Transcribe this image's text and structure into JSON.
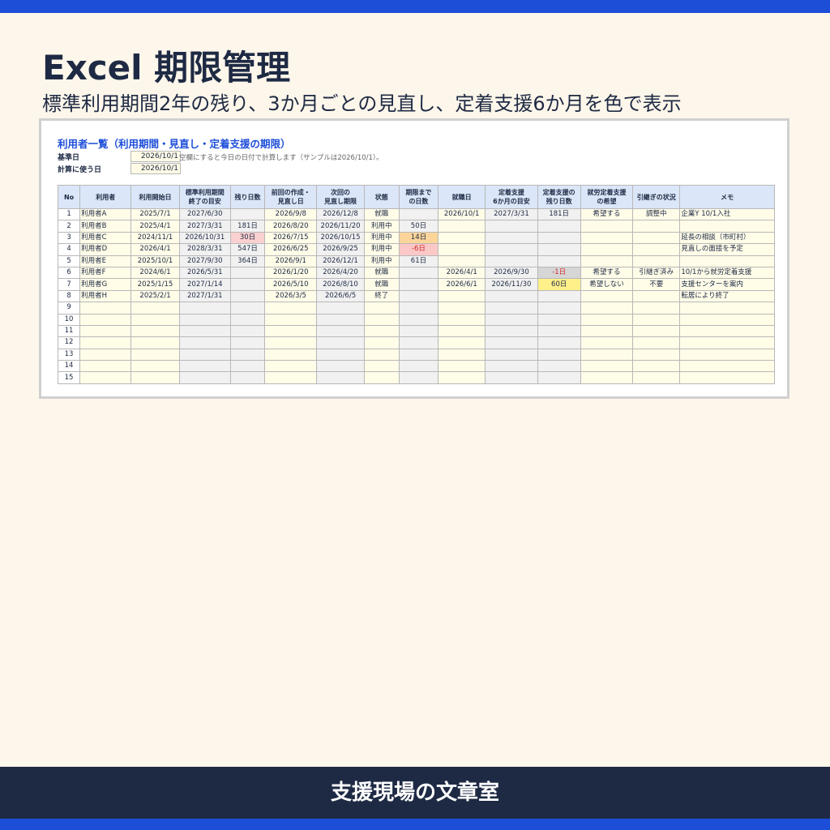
{
  "header": {
    "title": "Excel 期限管理",
    "subtitle": "標準利用期間2年の残り、3か月ごとの見直し、定着支援6か月を色で表示"
  },
  "sheet": {
    "title": "利用者一覧（利用期間・見直し・定着支援の期限）",
    "base_date_label": "基準日",
    "base_date_value": "2026/10/1",
    "base_date_note": "空欄にすると今日の日付で計算します（サンプルは2026/10/1）。",
    "calc_date_label": "計算に使う日",
    "calc_date_value": "2026/10/1",
    "columns": [
      "No",
      "利用者",
      "利用開始日",
      "標準利用期間\n終了の目安",
      "残り日数",
      "前回の作成・\n見直し日",
      "次回の\n見直し期限",
      "状態",
      "期限まで\nの日数",
      "就職日",
      "定着支援\n6か月の目安",
      "定着支援の\n残り日数",
      "就労定着支援\nの希望",
      "引継ぎの状況",
      "メモ"
    ],
    "rows": [
      [
        "1",
        "利用者A",
        "2025/7/1",
        "2027/6/30",
        "",
        "2026/9/8",
        "2026/12/8",
        "就職",
        "",
        "2026/10/1",
        "2027/3/31",
        "181日",
        "希望する",
        "調整中",
        "企業Y 10/1入社"
      ],
      [
        "2",
        "利用者B",
        "2025/4/1",
        "2027/3/31",
        "181日",
        "2026/8/20",
        "2026/11/20",
        "利用中",
        "50日",
        "",
        "",
        "",
        "",
        "",
        ""
      ],
      [
        "3",
        "利用者C",
        "2024/11/1",
        "2026/10/31",
        "30日",
        "2026/7/15",
        "2026/10/15",
        "利用中",
        "14日",
        "",
        "",
        "",
        "",
        "",
        "延長の相談（市町村）"
      ],
      [
        "4",
        "利用者D",
        "2026/4/1",
        "2028/3/31",
        "547日",
        "2026/6/25",
        "2026/9/25",
        "利用中",
        "-6日",
        "",
        "",
        "",
        "",
        "",
        "見直しの面接を予定"
      ],
      [
        "5",
        "利用者E",
        "2025/10/1",
        "2027/9/30",
        "364日",
        "2026/9/1",
        "2026/12/1",
        "利用中",
        "61日",
        "",
        "",
        "",
        "",
        "",
        ""
      ],
      [
        "6",
        "利用者F",
        "2024/6/1",
        "2026/5/31",
        "",
        "2026/1/20",
        "2026/4/20",
        "就職",
        "",
        "2026/4/1",
        "2026/9/30",
        "-1日",
        "希望する",
        "引継ぎ済み",
        "10/1から就労定着支援"
      ],
      [
        "7",
        "利用者G",
        "2025/1/15",
        "2027/1/14",
        "",
        "2026/5/10",
        "2026/8/10",
        "就職",
        "",
        "2026/6/1",
        "2026/11/30",
        "60日",
        "希望しない",
        "不要",
        "支援センターを案内"
      ],
      [
        "8",
        "利用者H",
        "2025/2/1",
        "2027/1/31",
        "",
        "2026/3/5",
        "2026/6/5",
        "終了",
        "",
        "",
        "",
        "",
        "",
        "",
        "転居により終了"
      ],
      [
        "9",
        "",
        "",
        "",
        "",
        "",
        "",
        "",
        "",
        "",
        "",
        "",
        "",
        "",
        ""
      ],
      [
        "10",
        "",
        "",
        "",
        "",
        "",
        "",
        "",
        "",
        "",
        "",
        "",
        "",
        "",
        ""
      ],
      [
        "11",
        "",
        "",
        "",
        "",
        "",
        "",
        "",
        "",
        "",
        "",
        "",
        "",
        "",
        ""
      ],
      [
        "12",
        "",
        "",
        "",
        "",
        "",
        "",
        "",
        "",
        "",
        "",
        "",
        "",
        "",
        ""
      ],
      [
        "13",
        "",
        "",
        "",
        "",
        "",
        "",
        "",
        "",
        "",
        "",
        "",
        "",
        "",
        ""
      ],
      [
        "14",
        "",
        "",
        "",
        "",
        "",
        "",
        "",
        "",
        "",
        "",
        "",
        "",
        "",
        ""
      ],
      [
        "15",
        "",
        "",
        "",
        "",
        "",
        "",
        "",
        "",
        "",
        "",
        "",
        "",
        "",
        ""
      ]
    ],
    "highlights": [
      {
        "row": 2,
        "col": 4,
        "style": "red-bg"
      },
      {
        "row": 2,
        "col": 8,
        "style": "orange-bg"
      },
      {
        "row": 3,
        "col": 8,
        "style": "pink-red"
      },
      {
        "row": 5,
        "col": 11,
        "style": "gray-red"
      },
      {
        "row": 6,
        "col": 11,
        "style": "yellow-bg"
      }
    ]
  },
  "footer": {
    "brand": "支援現場の文章室"
  },
  "colors": {
    "accent": "#1d4ed8",
    "navy": "#1e2a44",
    "background": "#fdf6ea",
    "header_cell": "#dbe6f8",
    "input_cell": "#fffce8",
    "formula_cell": "#f1f1f1"
  }
}
